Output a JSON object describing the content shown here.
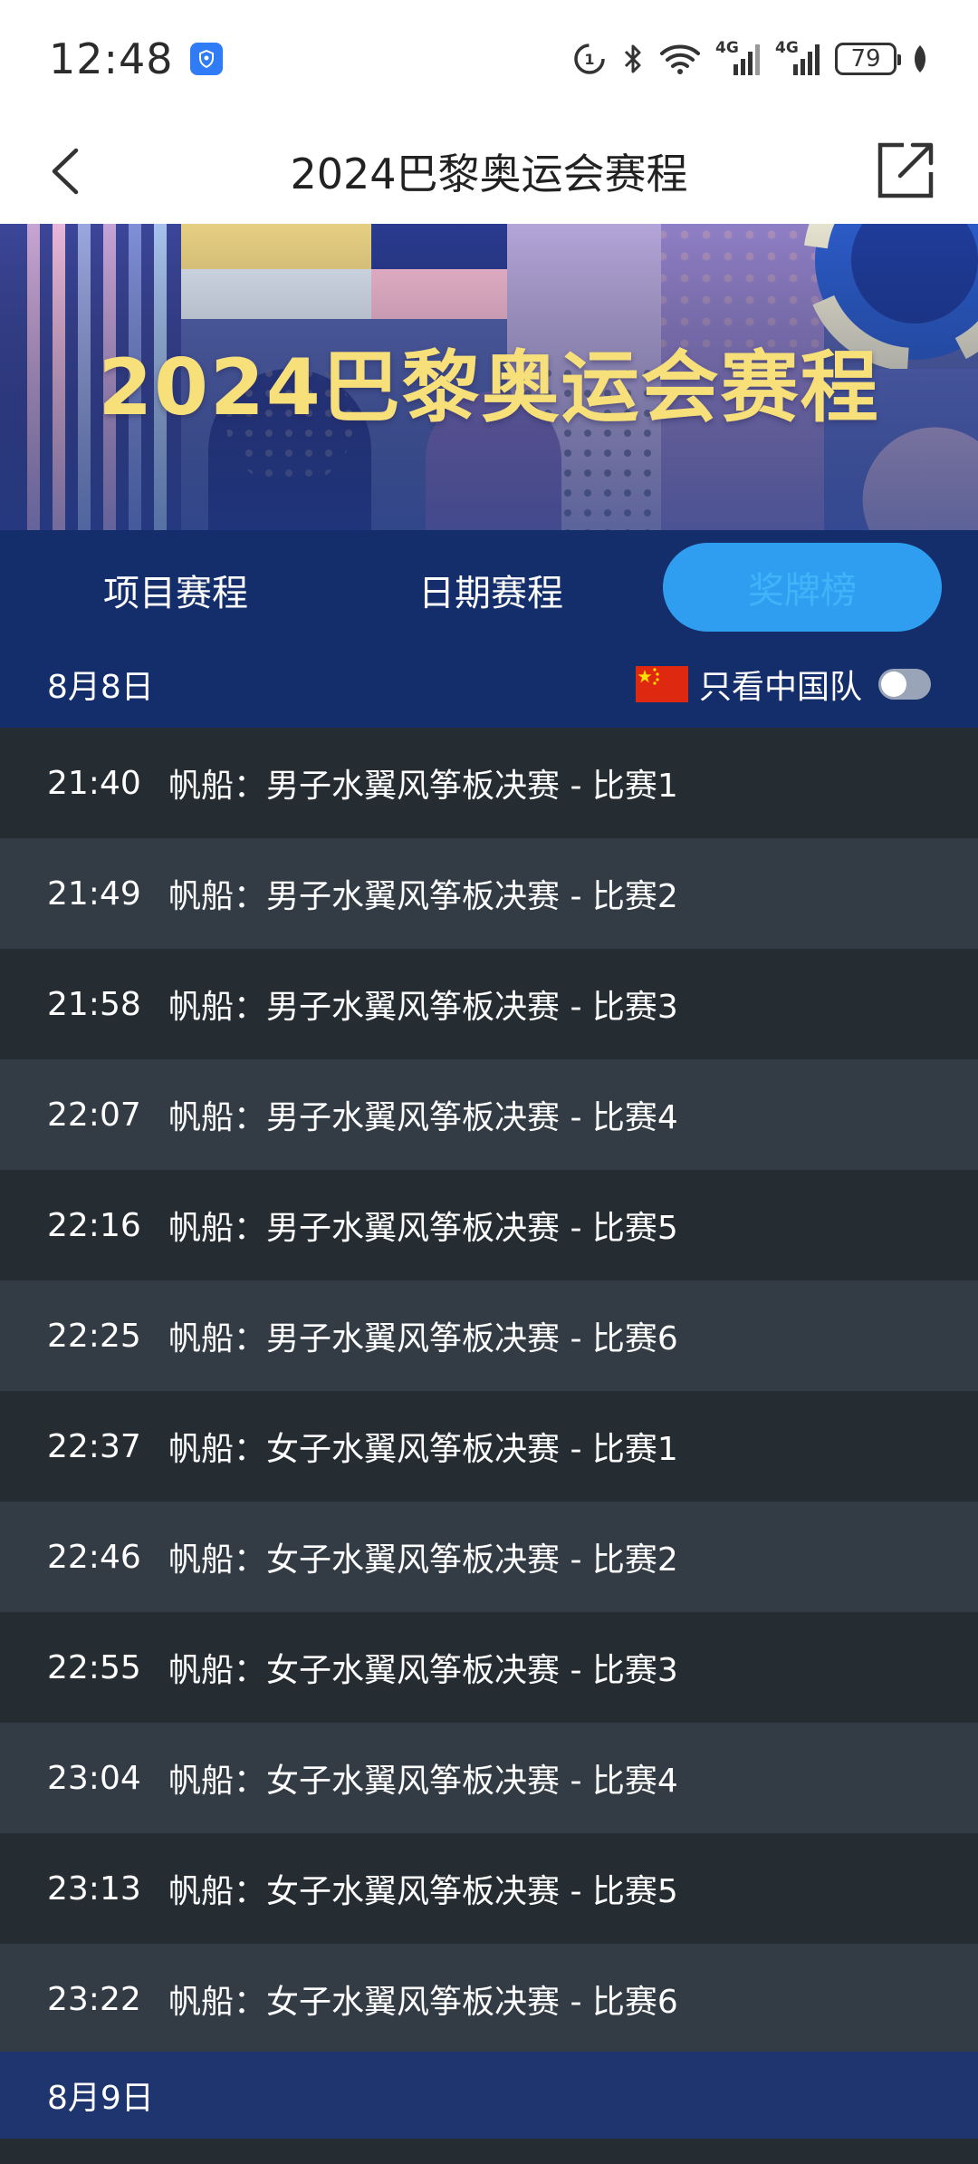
{
  "status_bar": {
    "time": "12:48",
    "network_1": "4G",
    "network_2": "4G",
    "battery": "79",
    "icons": [
      "app-shield-icon",
      "data-saver-icon",
      "bluetooth-icon",
      "wifi-icon",
      "signal-icon",
      "signal-icon",
      "battery-icon",
      "leaf-icon"
    ]
  },
  "header": {
    "title": "2024巴黎奥运会赛程",
    "back_icon": "back-chevron-icon",
    "share_icon": "share-external-icon"
  },
  "banner": {
    "title": "2024巴黎奥运会赛程"
  },
  "tabs": [
    {
      "label": "项目赛程"
    },
    {
      "label": "日期赛程"
    },
    {
      "label": "奖牌榜",
      "active": true
    }
  ],
  "schedule": {
    "date": "8月8日",
    "filter_label": "只看中国队",
    "filter_on": false,
    "flag": "china-flag",
    "next_date": "8月9日",
    "rows": [
      {
        "time": "21:40",
        "event": "帆船：男子水翼风筝板决赛 - 比赛1"
      },
      {
        "time": "21:49",
        "event": "帆船：男子水翼风筝板决赛 - 比赛2"
      },
      {
        "time": "21:58",
        "event": "帆船：男子水翼风筝板决赛 - 比赛3"
      },
      {
        "time": "22:07",
        "event": "帆船：男子水翼风筝板决赛 - 比赛4"
      },
      {
        "time": "22:16",
        "event": "帆船：男子水翼风筝板决赛 - 比赛5"
      },
      {
        "time": "22:25",
        "event": "帆船：男子水翼风筝板决赛 - 比赛6"
      },
      {
        "time": "22:37",
        "event": "帆船：女子水翼风筝板决赛 - 比赛1"
      },
      {
        "time": "22:46",
        "event": "帆船：女子水翼风筝板决赛 - 比赛2"
      },
      {
        "time": "22:55",
        "event": "帆船：女子水翼风筝板决赛 - 比赛3"
      },
      {
        "time": "23:04",
        "event": "帆船：女子水翼风筝板决赛 - 比赛4"
      },
      {
        "time": "23:13",
        "event": "帆船：女子水翼风筝板决赛 - 比赛5"
      },
      {
        "time": "23:22",
        "event": "帆船：女子水翼风筝板决赛 - 比赛6"
      }
    ]
  }
}
